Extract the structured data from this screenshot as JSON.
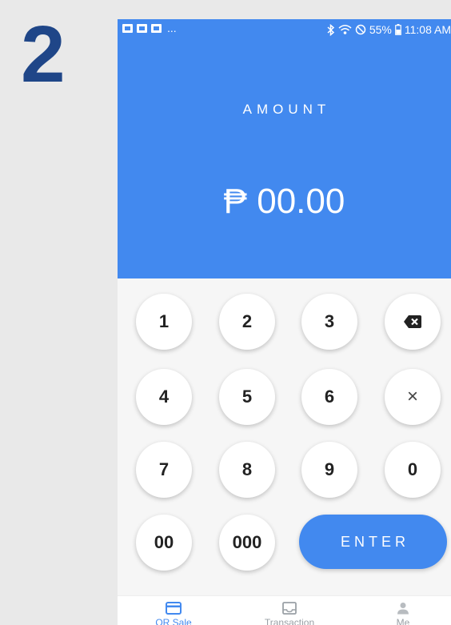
{
  "step": {
    "number": "2"
  },
  "status_bar": {
    "battery": "55%",
    "time": "11:08 AM",
    "overflow": "...",
    "icons": [
      "image-notif-icon",
      "flipboard-notif-icon",
      "flipboard-notif-icon",
      "bluetooth-icon",
      "wifi-icon",
      "do-not-disturb-icon",
      "battery-icon"
    ]
  },
  "header": {
    "label": "AMOUNT",
    "amount": "₱ 00.00",
    "color": "#4289ef"
  },
  "keypad": {
    "keys": [
      "1",
      "2",
      "3",
      "backspace-icon",
      "4",
      "5",
      "6",
      "×",
      "7",
      "8",
      "9",
      "0",
      "00",
      "000"
    ],
    "enter_label": "ENTER"
  },
  "bottom_nav": {
    "items": [
      {
        "label": "QR Sale",
        "icon": "card-icon",
        "active": true
      },
      {
        "label": "Transaction",
        "icon": "inbox-icon",
        "active": false
      },
      {
        "label": "Me",
        "icon": "person-icon",
        "active": false
      }
    ],
    "active_color": "#4289ef",
    "inactive_color": "#9aa0a6"
  }
}
